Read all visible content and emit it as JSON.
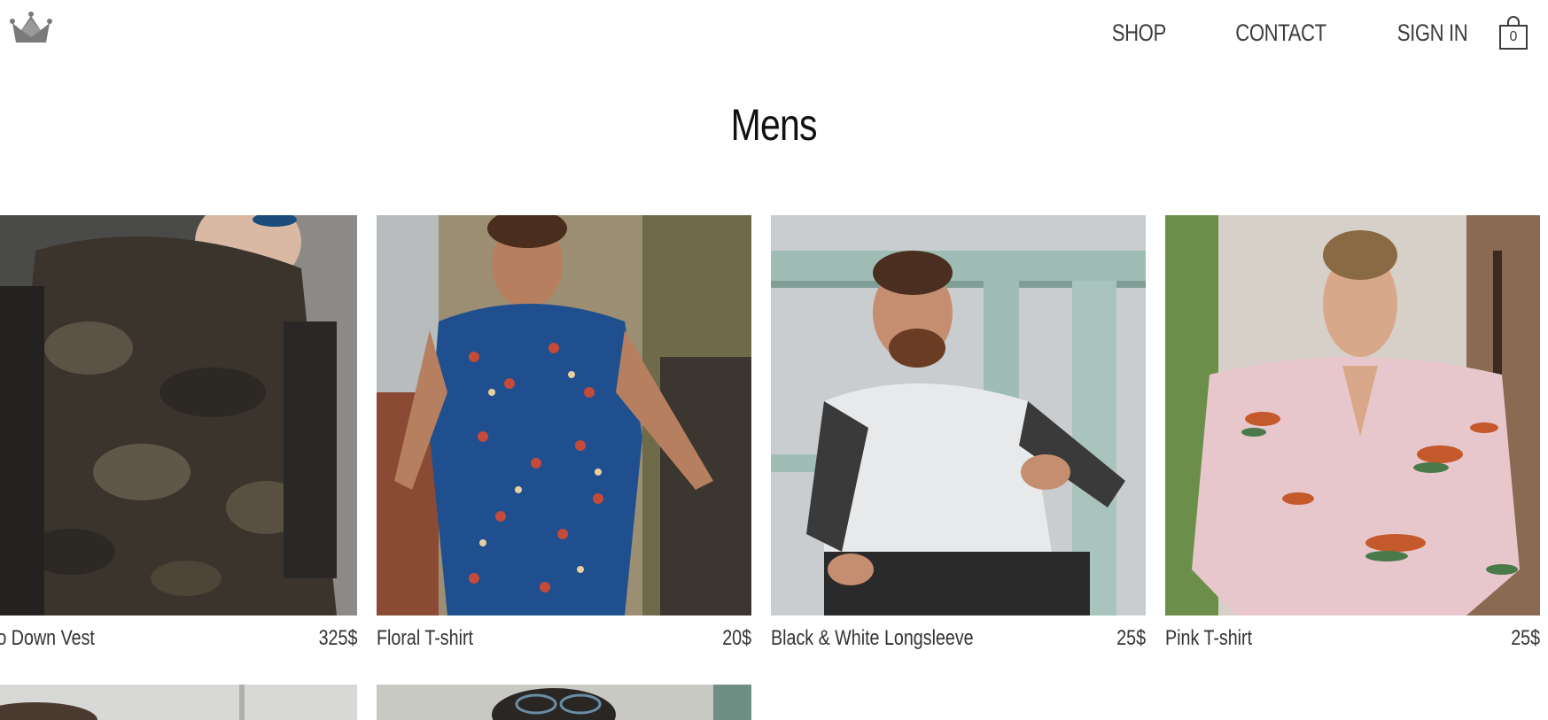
{
  "nav": {
    "shop": "SHOP",
    "contact": "CONTACT",
    "sign_in": "SIGN IN",
    "cart_count": "0"
  },
  "page": {
    "title": "Mens"
  },
  "products": [
    {
      "name": "Camo Down Vest",
      "visible_name": "mo Down Vest",
      "price": "325$"
    },
    {
      "name": "Floral T-shirt",
      "visible_name": "Floral T-shirt",
      "price": "20$"
    },
    {
      "name": "Black & White Longsleeve",
      "visible_name": "Black & White Longsleeve",
      "price": "25$"
    },
    {
      "name": "Pink T-shirt",
      "visible_name": "Pink T-shirt",
      "price": "25$"
    }
  ],
  "icons": {
    "logo": "crown-icon",
    "cart": "shopping-bag-icon"
  },
  "colors": {
    "text": "#3d3d3d",
    "title": "#111111",
    "background": "#ffffff"
  }
}
